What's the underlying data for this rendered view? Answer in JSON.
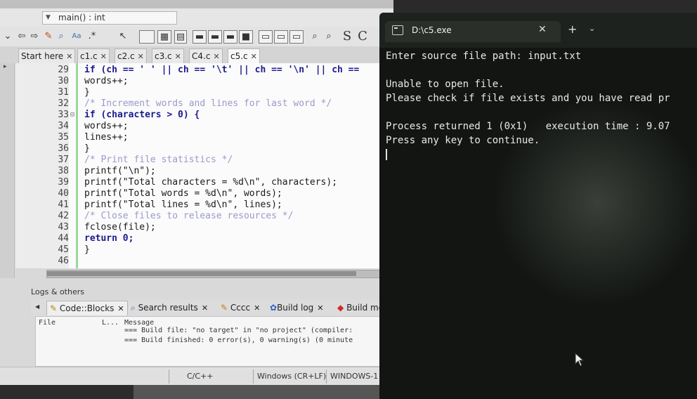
{
  "ide": {
    "function_selector": "main() : int",
    "toolbar_letters": [
      "S",
      "C"
    ],
    "tabs": [
      {
        "label": "Start here"
      },
      {
        "label": "c1.c"
      },
      {
        "label": "c2.c"
      },
      {
        "label": "c3.c"
      },
      {
        "label": "C4.c"
      },
      {
        "label": "c5.c"
      }
    ],
    "code_lines": [
      {
        "n": "29",
        "text": "if (ch == ' ' || ch == '\\t' || ch == '\\n' || ch =="
      },
      {
        "n": "30",
        "text": "words++;"
      },
      {
        "n": "31",
        "text": "}"
      },
      {
        "n": "32",
        "text": "/* Increment words and lines for last word */"
      },
      {
        "n": "33",
        "text": "if (characters > 0) {"
      },
      {
        "n": "34",
        "text": "words++;"
      },
      {
        "n": "35",
        "text": "lines++;"
      },
      {
        "n": "36",
        "text": "}"
      },
      {
        "n": "37",
        "text": "/* Print file statistics */"
      },
      {
        "n": "38",
        "text": "printf(\"\\n\");"
      },
      {
        "n": "39",
        "text": "printf(\"Total characters = %d\\n\", characters);"
      },
      {
        "n": "40",
        "text": "printf(\"Total words = %d\\n\", words);"
      },
      {
        "n": "41",
        "text": "printf(\"Total lines = %d\\n\", lines);"
      },
      {
        "n": "42",
        "text": "/* Close files to release resources */"
      },
      {
        "n": "43",
        "text": "fclose(file);"
      },
      {
        "n": "44",
        "text": "return 0;"
      },
      {
        "n": "45",
        "text": "}"
      },
      {
        "n": "46",
        "text": ""
      }
    ],
    "logs_title": "Logs & others",
    "log_tabs": [
      {
        "label": "Code::Blocks"
      },
      {
        "label": "Search results"
      },
      {
        "label": "Cccc"
      },
      {
        "label": "Build log"
      },
      {
        "label": "Build me"
      }
    ],
    "log_header": {
      "file": "File",
      "line": "L...",
      "message": "Message"
    },
    "log_rows": [
      "=== Build file: \"no target\" in \"no project\" (compiler:",
      "=== Build finished: 0 error(s), 0 warning(s) (0 minute"
    ],
    "status": {
      "language": "C/C++",
      "eol": "Windows (CR+LF)",
      "encoding": "WINDOWS-1"
    }
  },
  "terminal": {
    "title": "D:\\c5.exe",
    "lines": [
      "Enter source file path: input.txt",
      "",
      "Unable to open file.",
      "Please check if file exists and you have read pr",
      "",
      "Process returned 1 (0x1)   execution time : 9.07",
      "Press any key to continue."
    ]
  }
}
